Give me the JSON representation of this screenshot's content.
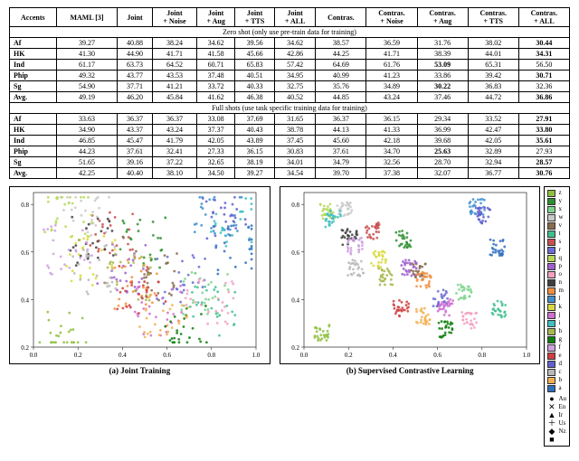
{
  "table_caption": "",
  "table": {
    "headers": [
      "Accents",
      "MAML [3]",
      "Joint",
      {
        "l1": "Joint",
        "l2": "+ Noise"
      },
      {
        "l1": "Joint",
        "l2": "+ Aug"
      },
      {
        "l1": "Joint",
        "l2": "+ TTS"
      },
      {
        "l1": "Joint",
        "l2": "+ ALL"
      },
      "Contras.",
      {
        "l1": "Contras.",
        "l2": "+ Noise"
      },
      {
        "l1": "Contras.",
        "l2": "+ Aug"
      },
      {
        "l1": "Contras.",
        "l2": "+ TTS"
      },
      {
        "l1": "Contras.",
        "l2": "+ ALL"
      }
    ],
    "section1": "Zero shot (only use pre-train data for training)",
    "rows1": [
      {
        "acc": "Af",
        "v": [
          "39.27",
          "40.88",
          "38.24",
          "34.62",
          "39.56",
          "34.62",
          "38.57",
          "36.59",
          "31.76",
          "38.02"
        ],
        "bold": "30.44"
      },
      {
        "acc": "HK",
        "v": [
          "41.30",
          "44.90",
          "41.71",
          "41.58",
          "45.66",
          "42.86",
          "44.25",
          "41.71",
          "38.39",
          "44.01"
        ],
        "bold": "34.31"
      },
      {
        "acc": "Ind",
        "v": [
          "61.17",
          "63.73",
          "64.52",
          "60.71",
          "65.83",
          "57.42",
          "64.69",
          "61.76"
        ],
        "boldmid": {
          "idx": 8,
          "val": "53.09"
        },
        "tail": [
          "65.31",
          "56.50"
        ]
      },
      {
        "acc": "Phip",
        "v": [
          "49.32",
          "43.77",
          "43.53",
          "37.48",
          "40.51",
          "34.95",
          "40.99",
          "41.23",
          "33.86",
          "39.42"
        ],
        "bold": "30.71"
      },
      {
        "acc": "Sg",
        "v": [
          "54.90",
          "37.71",
          "41.21",
          "33.72",
          "40.33",
          "32.75",
          "35.76",
          "34.89"
        ],
        "boldmid": {
          "idx": 8,
          "val": "30.22"
        },
        "tail": [
          "36.83",
          "32.36"
        ]
      },
      {
        "acc": "Avg.",
        "v": [
          "49.19",
          "46.20",
          "45.84",
          "41.62",
          "46.38",
          "40.52",
          "44.85",
          "43.24",
          "37.46",
          "44.72"
        ],
        "bold": "36.86"
      }
    ],
    "section2": "Full shots (use task specific training data for training)",
    "rows2": [
      {
        "acc": "Af",
        "v": [
          "33.63",
          "36.37",
          "36.37",
          "33.08",
          "37.69",
          "31.65",
          "36.37",
          "36.15",
          "29.34",
          "33.52"
        ],
        "bold": "27.91"
      },
      {
        "acc": "HK",
        "v": [
          "34.90",
          "43.37",
          "43.24",
          "37.37",
          "40.43",
          "38.78",
          "44.13",
          "41.33",
          "36.99",
          "42.47"
        ],
        "bold": "33.80"
      },
      {
        "acc": "Ind",
        "v": [
          "46.85",
          "45.47",
          "41.79",
          "42.05",
          "43.89",
          "37.45",
          "45.60",
          "42.18",
          "39.68",
          "42.05"
        ],
        "bold": "35.61"
      },
      {
        "acc": "Phip",
        "v": [
          "44.23",
          "37.61",
          "32.41",
          "27.33",
          "36.15",
          "30.83",
          "37.61",
          "34.70"
        ],
        "boldmid": {
          "idx": 8,
          "val": "25.63"
        },
        "tail": [
          "32.89",
          "27.93"
        ]
      },
      {
        "acc": "Sg",
        "v": [
          "51.65",
          "39.16",
          "37.22",
          "32.65",
          "38.19",
          "34.01",
          "34.79",
          "32.56",
          "28.70",
          "32.94"
        ],
        "bold": "28.57"
      },
      {
        "acc": "Avg.",
        "v": [
          "42.25",
          "40.40",
          "38.10",
          "34.50",
          "39.27",
          "34.54",
          "39.70",
          "37.38",
          "32.07",
          "36.77"
        ],
        "bold": "30.76"
      }
    ]
  },
  "chart_data": [
    {
      "type": "scatter",
      "title": "(a) Joint Training",
      "xlim": [
        0.0,
        1.0
      ],
      "ylim": [
        0.2,
        0.85
      ],
      "xticks": [
        0.0,
        0.2,
        0.4,
        0.6,
        0.8,
        1.0
      ],
      "yticks": [
        0.2,
        0.4,
        0.6,
        0.8
      ],
      "description": "Dense t-SNE cloud; clusters overlap and bleed into one another, forming a crowded central region with many colors mixed."
    },
    {
      "type": "scatter",
      "title": "(b) Supervised Contrastive Learning",
      "xlim": [
        0.0,
        1.0
      ],
      "ylim": [
        0.2,
        0.85
      ],
      "xticks": [
        0.0,
        0.2,
        0.4,
        0.6,
        0.8,
        1.0
      ],
      "yticks": [
        0.2,
        0.4,
        0.6,
        0.8
      ],
      "description": "t-SNE clusters are compact and well separated — each color forms its own tight island with whitespace between them."
    }
  ],
  "legend": {
    "colors": [
      {
        "label": "z",
        "hex": "#8fbf3f"
      },
      {
        "label": "y",
        "hex": "#2f8f2f"
      },
      {
        "label": "x",
        "hex": "#7fd38f"
      },
      {
        "label": "w",
        "hex": "#c9c9c9"
      },
      {
        "label": "v",
        "hex": "#8a6b4f"
      },
      {
        "label": "t",
        "hex": "#3fbf8f"
      },
      {
        "label": "s",
        "hex": "#c94f4f"
      },
      {
        "label": "r",
        "hex": "#6b6bd3"
      },
      {
        "label": "q",
        "hex": "#b6d957"
      },
      {
        "label": "p",
        "hex": "#9f5fcf"
      },
      {
        "label": "o",
        "hex": "#f2a0c0"
      },
      {
        "label": "n",
        "hex": "#3f3f3f"
      },
      {
        "label": "m",
        "hex": "#f28f3f"
      },
      {
        "label": "l",
        "hex": "#3f8fcf"
      },
      {
        "label": "k",
        "hex": "#d9d93f"
      },
      {
        "label": "j",
        "hex": "#cf6fcf"
      },
      {
        "label": "i",
        "hex": "#3fbfbf"
      },
      {
        "label": "h",
        "hex": "#a8b84f"
      },
      {
        "label": "g",
        "hex": "#0f7f0f"
      },
      {
        "label": "f",
        "hex": "#cfa0e0"
      },
      {
        "label": "e",
        "hex": "#cf3f3f"
      },
      {
        "label": "d",
        "hex": "#5f5fcf"
      },
      {
        "label": "c",
        "hex": "#b8b8b8"
      },
      {
        "label": "b",
        "hex": "#f2b04f"
      },
      {
        "label": "a",
        "hex": "#2f6fbf"
      }
    ],
    "markers": [
      {
        "label": "Au",
        "glyph": "●"
      },
      {
        "label": "En",
        "glyph": "✕"
      },
      {
        "label": "Ir",
        "glyph": "▲"
      },
      {
        "label": "Us",
        "glyph": "＋"
      },
      {
        "label": "Nz",
        "glyph": "◆"
      },
      {
        "label": "",
        "glyph": "■"
      }
    ]
  },
  "fig_caption": ""
}
